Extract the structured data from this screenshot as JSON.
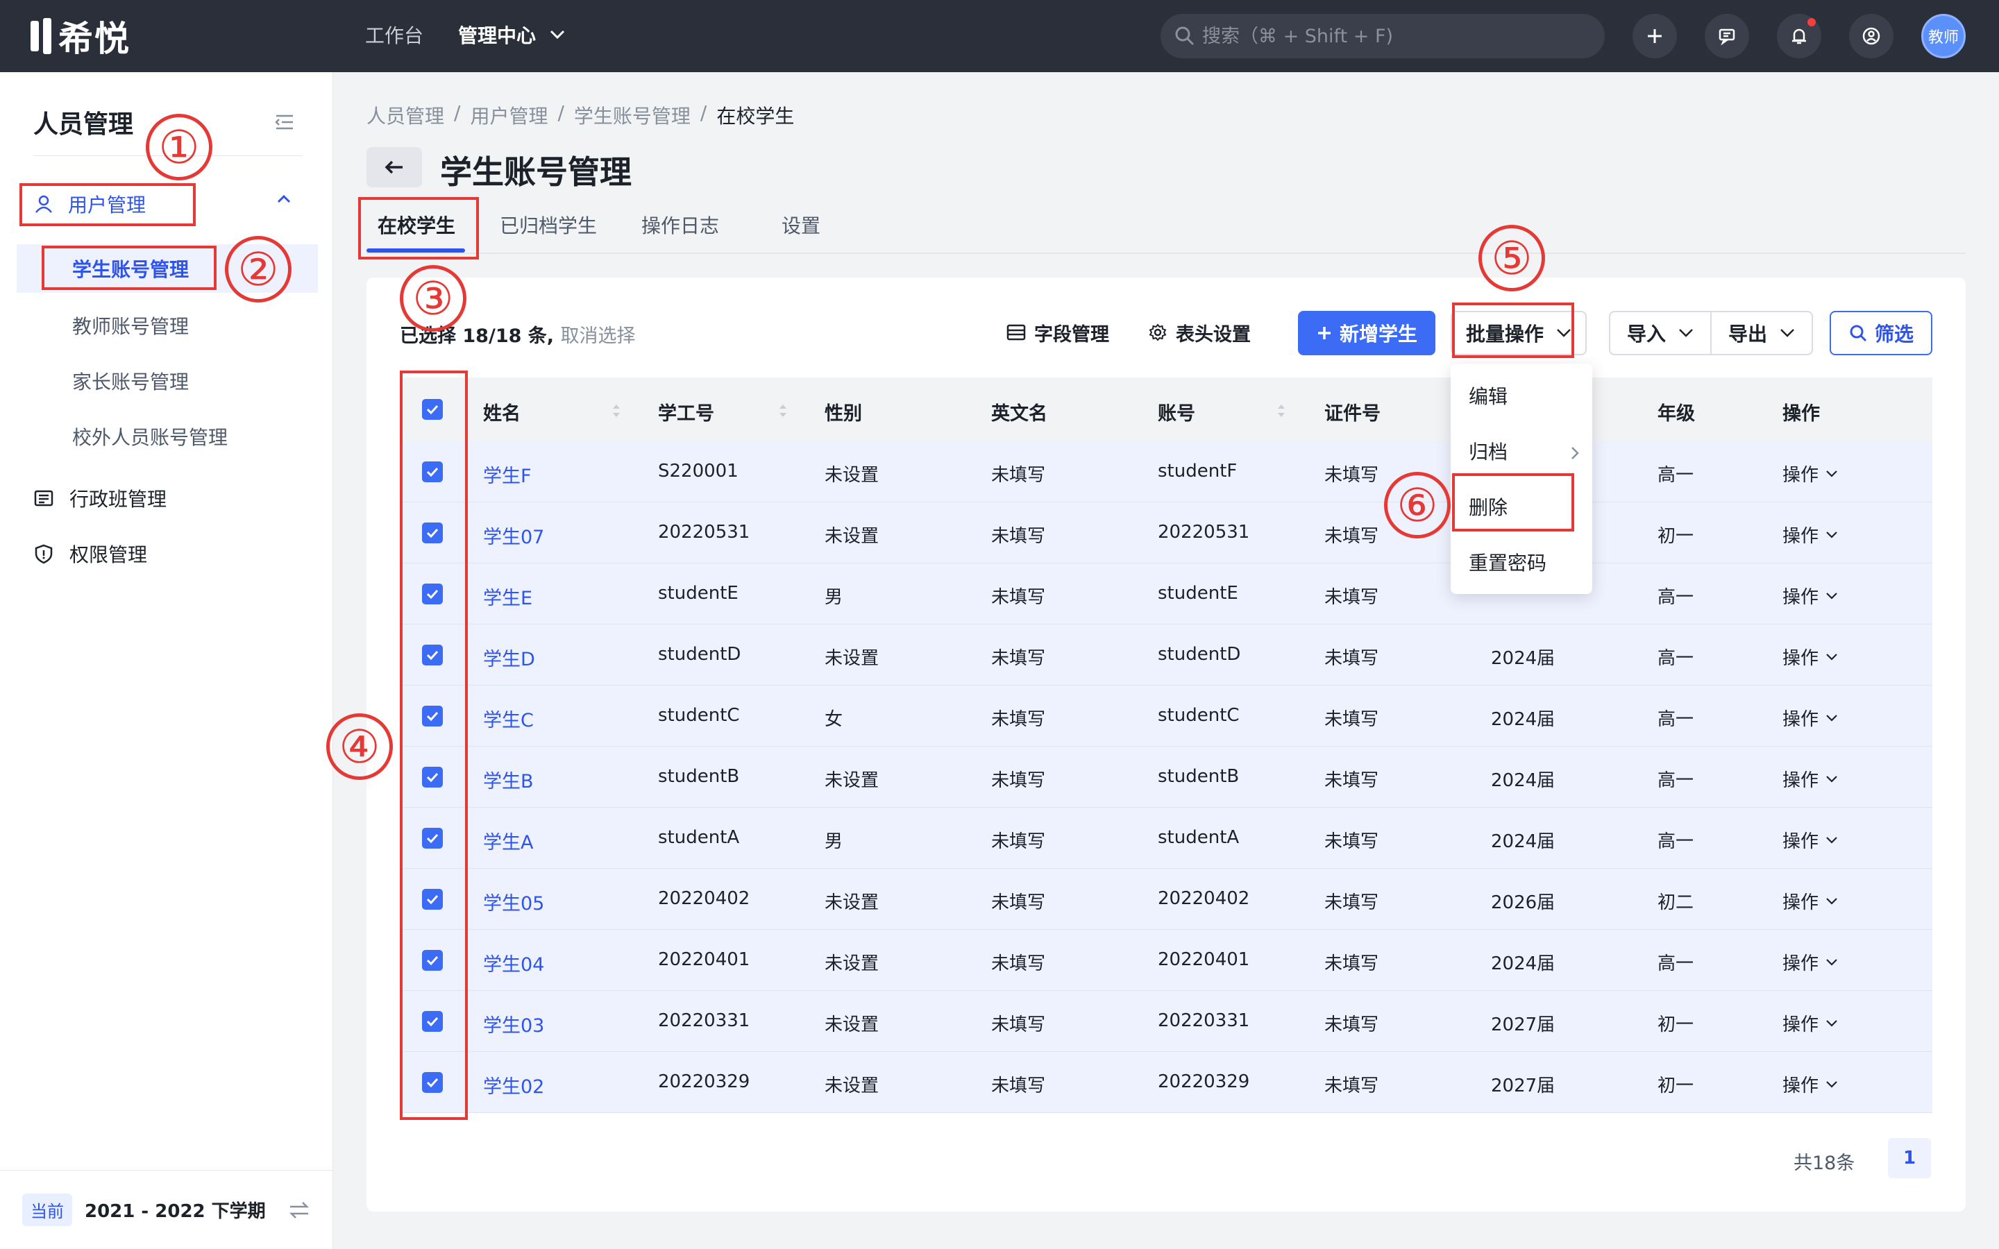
{
  "app": {
    "logo_text": "希悦"
  },
  "topnav": {
    "workbench": "工作台",
    "admin_center": "管理中心"
  },
  "search": {
    "placeholder": "搜索（⌘ + Shift + F)"
  },
  "user": {
    "avatar_label": "教师"
  },
  "sidebar": {
    "title": "人员管理",
    "group_user": "用户管理",
    "sub_items": [
      "学生账号管理",
      "教师账号管理",
      "家长账号管理",
      "校外人员账号管理"
    ],
    "class_mgmt": "行政班管理",
    "perm_mgmt": "权限管理",
    "footer_badge": "当前",
    "footer_term": "2021 - 2022 下学期"
  },
  "breadcrumb": [
    "人员管理",
    "用户管理",
    "学生账号管理",
    "在校学生"
  ],
  "page_title": "学生账号管理",
  "tabs": [
    "在校学生",
    "已归档学生",
    "操作日志",
    "设置"
  ],
  "toolbar": {
    "selected": "已选择 18/18 条,",
    "cancel": "取消选择",
    "field_mgmt": "字段管理",
    "header_settings": "表头设置",
    "add_student": "新增学生",
    "batch_ops": "批量操作",
    "import": "导入",
    "export": "导出",
    "filter": "筛选"
  },
  "columns": [
    "姓名",
    "学工号",
    "性别",
    "英文名",
    "账号",
    "证件号",
    "年级",
    "操作"
  ],
  "rows": [
    {
      "name": "学生F",
      "id": "S220001",
      "gender": "未设置",
      "en": "未填写",
      "account": "studentF",
      "cert": "未填写",
      "cohort": "",
      "grade": "高一",
      "op": "操作"
    },
    {
      "name": "学生07",
      "id": "20220531",
      "gender": "未设置",
      "en": "未填写",
      "account": "20220531",
      "cert": "未填写",
      "cohort": "",
      "grade": "初一",
      "op": "操作"
    },
    {
      "name": "学生E",
      "id": "studentE",
      "gender": "男",
      "en": "未填写",
      "account": "studentE",
      "cert": "未填写",
      "cohort": "",
      "grade": "高一",
      "op": "操作"
    },
    {
      "name": "学生D",
      "id": "studentD",
      "gender": "未设置",
      "en": "未填写",
      "account": "studentD",
      "cert": "未填写",
      "cohort": "2024届",
      "grade": "高一",
      "op": "操作"
    },
    {
      "name": "学生C",
      "id": "studentC",
      "gender": "女",
      "en": "未填写",
      "account": "studentC",
      "cert": "未填写",
      "cohort": "2024届",
      "grade": "高一",
      "op": "操作"
    },
    {
      "name": "学生B",
      "id": "studentB",
      "gender": "未设置",
      "en": "未填写",
      "account": "studentB",
      "cert": "未填写",
      "cohort": "2024届",
      "grade": "高一",
      "op": "操作"
    },
    {
      "name": "学生A",
      "id": "studentA",
      "gender": "男",
      "en": "未填写",
      "account": "studentA",
      "cert": "未填写",
      "cohort": "2024届",
      "grade": "高一",
      "op": "操作"
    },
    {
      "name": "学生05",
      "id": "20220402",
      "gender": "未设置",
      "en": "未填写",
      "account": "20220402",
      "cert": "未填写",
      "cohort": "2026届",
      "grade": "初二",
      "op": "操作"
    },
    {
      "name": "学生04",
      "id": "20220401",
      "gender": "未设置",
      "en": "未填写",
      "account": "20220401",
      "cert": "未填写",
      "cohort": "2024届",
      "grade": "高一",
      "op": "操作"
    },
    {
      "name": "学生03",
      "id": "20220331",
      "gender": "未设置",
      "en": "未填写",
      "account": "20220331",
      "cert": "未填写",
      "cohort": "2027届",
      "grade": "初一",
      "op": "操作"
    },
    {
      "name": "学生02",
      "id": "20220329",
      "gender": "未设置",
      "en": "未填写",
      "account": "20220329",
      "cert": "未填写",
      "cohort": "2027届",
      "grade": "初一",
      "op": "操作"
    }
  ],
  "dropdown": [
    "编辑",
    "归档",
    "删除",
    "重置密码"
  ],
  "pager": {
    "total": "共18条",
    "page": "1"
  },
  "annotations": [
    "①",
    "②",
    "③",
    "④",
    "⑤",
    "⑥"
  ],
  "colors": {
    "accent": "#3c6cf6",
    "annotation": "#e53935",
    "topbar": "#2b2f3a"
  }
}
